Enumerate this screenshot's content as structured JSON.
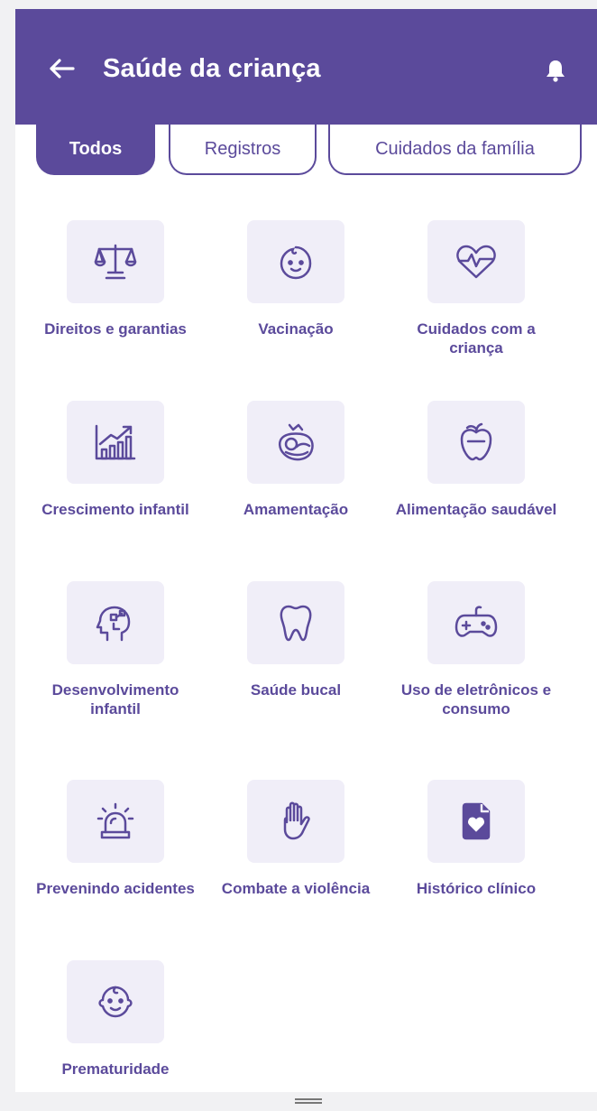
{
  "header": {
    "title": "Saúde da criança",
    "back_icon": "arrow-left-icon",
    "bell_icon": "bell-icon",
    "color": "#5b4a9b"
  },
  "filters": [
    {
      "label": "Todos",
      "active": true
    },
    {
      "label": "Registros",
      "active": false
    },
    {
      "label": "Cuidados da família",
      "active": false
    }
  ],
  "tiles": [
    {
      "label": "Direitos e garantias",
      "icon": "scale-icon"
    },
    {
      "label": "Vacinação",
      "icon": "baby-face-icon"
    },
    {
      "label": "Cuidados com a criança",
      "icon": "heart-pulse-icon"
    },
    {
      "label": "Crescimento infantil",
      "icon": "growth-chart-icon"
    },
    {
      "label": "Amamentação",
      "icon": "breastfeeding-icon"
    },
    {
      "label": "Alimentação saudável",
      "icon": "apple-icon"
    },
    {
      "label": "Desenvolvimento infantil",
      "icon": "brain-head-icon"
    },
    {
      "label": "Saúde bucal",
      "icon": "tooth-icon"
    },
    {
      "label": "Uso de eletrônicos e consumo",
      "icon": "gamepad-icon"
    },
    {
      "label": "Prevenindo acidentes",
      "icon": "siren-icon"
    },
    {
      "label": "Combate a violência",
      "icon": "stop-hand-icon"
    },
    {
      "label": "Histórico clínico",
      "icon": "medical-record-icon"
    },
    {
      "label": "Prematuridade",
      "icon": "baby-icon"
    }
  ]
}
